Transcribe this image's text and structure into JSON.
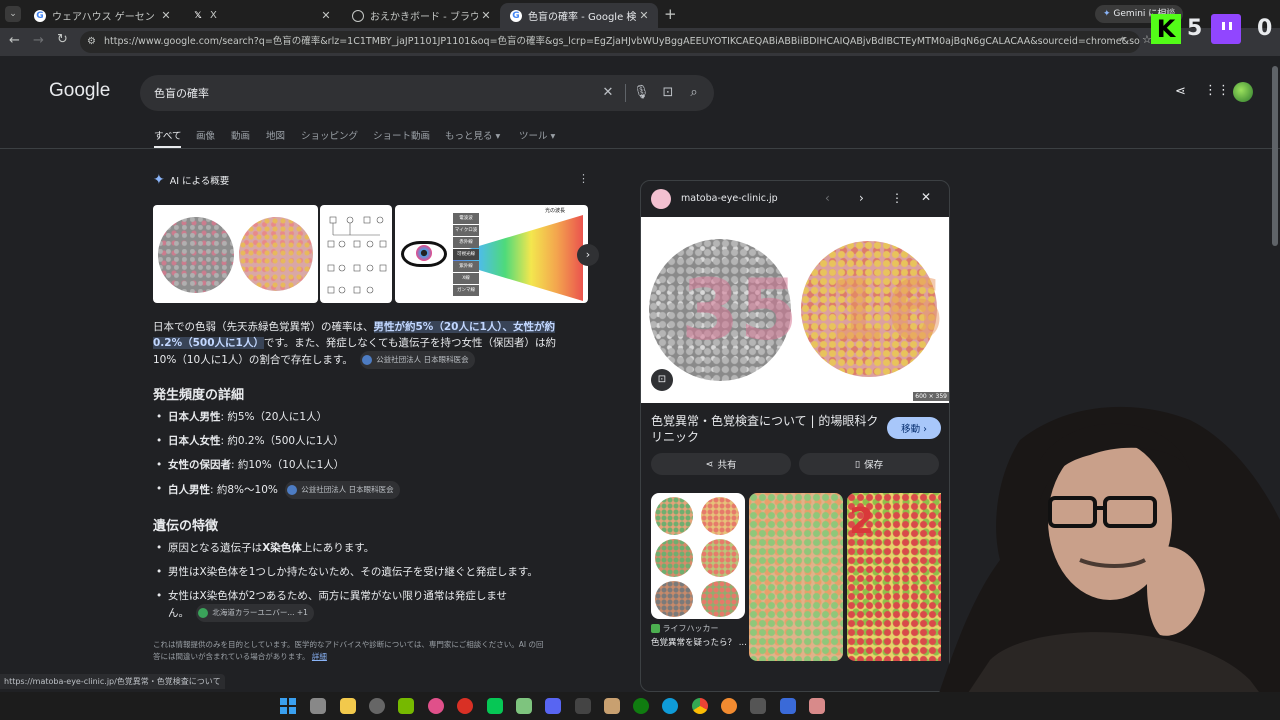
{
  "browser": {
    "tabs": [
      {
        "title": "ウェアハウス ゲーセン 岩槻 - Googl",
        "active": false
      },
      {
        "title": "X",
        "active": false
      },
      {
        "title": "おえかきボード - ブラウザでかんたん",
        "active": false
      },
      {
        "title": "色盲の確率 - Google 検索",
        "active": true
      }
    ],
    "new_tab_label": "+",
    "gemini_label": "Gemini に相談",
    "url": "https://www.google.com/search?q=色盲の確率&rlz=1C1TMBY_jaJP1101JP1101&oq=色盲の確率&gs_lcrp=EgZjaHJvbWUyBggAEEUYOTIKCAEQABiABBiiBDIHCAIQABjvBdIBCTEyMTM0ajBqN6gCALACAA&sourceid=chrome&source=chrome.ob&i..."
  },
  "overlay": {
    "k_label": "K",
    "k_count": "5",
    "right_count": "0"
  },
  "google": {
    "logo": "Google",
    "query": "色盲の確率",
    "tabs": [
      "すべて",
      "画像",
      "動画",
      "地図",
      "ショッピング",
      "ショート動画",
      "もっと見る ▾",
      "ツール ▾"
    ]
  },
  "ai_overview": {
    "header": "AI による概要",
    "spectrum_labels": [
      "電波波",
      "マイクロ波",
      "赤外線",
      "可視光線",
      "紫外線",
      "X線",
      "ガンマ線"
    ],
    "spectrum_title": "光の波長",
    "summary_before": "日本での色弱（先天赤緑色覚異常）の確率は、",
    "summary_highlight_1": "男性が約5%（20人に1人）、女性が約",
    "summary_highlight_2": "0.2%（500人に1人）",
    "summary_after_1": "です。また、発症しなくても遺伝子を持つ女性（保因者）は約",
    "summary_after_2": "10%（10人に1人）の割合で存在します。",
    "source_chip": "公益社団法人 日本眼科医会",
    "section1_title": "発生頻度の詳細",
    "section1_items": [
      {
        "bold": "日本人男性",
        "text": ": 約5%（20人に1人）"
      },
      {
        "bold": "日本人女性",
        "text": ": 約0.2%（500人に1人）"
      },
      {
        "bold": "女性の保因者",
        "text": ": 約10%（10人に1人）"
      },
      {
        "bold": "白人男性",
        "text": ": 約8%〜10%"
      }
    ],
    "section1_chip": "公益社団法人 日本眼科医会",
    "section2_title": "遺伝の特徴",
    "section2_item1_pre": "原因となる遺伝子は",
    "section2_item1_bold": "X染色体",
    "section2_item1_post": "上にあります。",
    "section2_item2": "男性はX染色体を1つしか持たないため、その遺伝子を受け継ぐと発症します。",
    "section2_item3_a": "女性はX染色体が2つあるため、両方に異常がない限り通常は発症しませ",
    "section2_item3_b": "ん。",
    "section2_chip": "北海道カラーユニバー...",
    "section2_chip_extra": "+1",
    "disclaimer_1": "これは情報提供のみを目的としています。医学的なアドバイスや診断については、専門家にご相談ください。AI の回",
    "disclaimer_2": "答には間違いが含まれている場合があります。",
    "disclaimer_link": "詳細"
  },
  "panel": {
    "site": "matoba-eye-clinic.jp",
    "image_size": "600 × 359",
    "plate_numbers": [
      "35",
      "16"
    ],
    "title_1": "色覚異常・色覚検査について | 的場眼科ク",
    "title_2": "リニック",
    "visit_label": "移動 ›",
    "share_label": "共有",
    "save_label": "保存",
    "related_source": "ライフハッカー",
    "related_caption": "色覚異常を疑ったら？ ...",
    "related_plate_numbers": [
      "2"
    ]
  },
  "status_url": "https://matoba-eye-clinic.jp/色覚異常・色覚検査について"
}
